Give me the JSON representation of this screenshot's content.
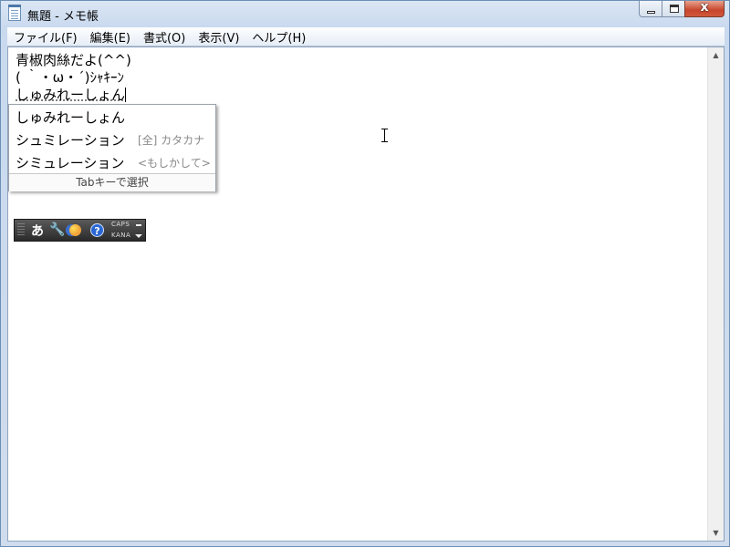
{
  "window": {
    "title": "無題 - メモ帳",
    "close_glyph": "x"
  },
  "menu": [
    "ファイル(F)",
    "編集(E)",
    "書式(O)",
    "表示(V)",
    "ヘルプ(H)"
  ],
  "editor": {
    "lines": [
      "青椒肉絲だよ(^^)",
      "( ｀・ω・´)ｼｬｷｰﾝ",
      "しゅみれーしょん"
    ]
  },
  "ime_candidates": {
    "items": [
      {
        "text": "しゅみれーしょん",
        "note": ""
      },
      {
        "text": "シュミレーション",
        "note": "[全] カタカナ"
      },
      {
        "text": "シミュレーション",
        "note": "<もしかして>"
      }
    ],
    "footer": "Tabキーで選択"
  },
  "ime_bar": {
    "mode": "あ",
    "help_glyph": "?",
    "caps": "CAPS",
    "kana": "KANA",
    "icons": [
      "grip-icon",
      "wrench-icon",
      "ime-pad-icon",
      "help-icon",
      "dash-icon",
      "dropdown-icon"
    ]
  },
  "scrollbar": {
    "up_glyph": "▲",
    "down_glyph": "▼"
  }
}
